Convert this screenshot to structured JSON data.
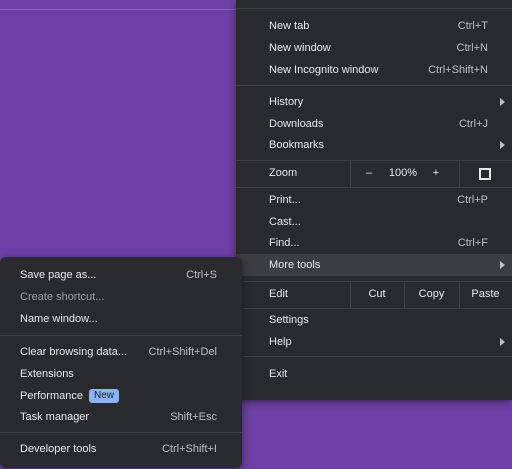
{
  "main_menu": {
    "new_tab": {
      "label": "New tab",
      "shortcut": "Ctrl+T"
    },
    "new_window": {
      "label": "New window",
      "shortcut": "Ctrl+N"
    },
    "new_incognito": {
      "label": "New Incognito window",
      "shortcut": "Ctrl+Shift+N"
    },
    "history": {
      "label": "History"
    },
    "downloads": {
      "label": "Downloads",
      "shortcut": "Ctrl+J"
    },
    "bookmarks": {
      "label": "Bookmarks"
    },
    "zoom": {
      "label": "Zoom",
      "minus": "–",
      "value": "100%",
      "plus": "+"
    },
    "print": {
      "label": "Print...",
      "shortcut": "Ctrl+P"
    },
    "cast": {
      "label": "Cast..."
    },
    "find": {
      "label": "Find...",
      "shortcut": "Ctrl+F"
    },
    "more_tools": {
      "label": "More tools"
    },
    "edit": {
      "label": "Edit",
      "cut": "Cut",
      "copy": "Copy",
      "paste": "Paste"
    },
    "settings": {
      "label": "Settings"
    },
    "help": {
      "label": "Help"
    },
    "exit": {
      "label": "Exit"
    }
  },
  "more_tools_menu": {
    "save_page": {
      "label": "Save page as...",
      "shortcut": "Ctrl+S"
    },
    "create_shortcut": {
      "label": "Create shortcut..."
    },
    "name_window": {
      "label": "Name window..."
    },
    "clear_browsing": {
      "label": "Clear browsing data...",
      "shortcut": "Ctrl+Shift+Del"
    },
    "extensions": {
      "label": "Extensions"
    },
    "performance": {
      "label": "Performance",
      "badge": "New"
    },
    "task_manager": {
      "label": "Task manager",
      "shortcut": "Shift+Esc"
    },
    "developer_tools": {
      "label": "Developer tools",
      "shortcut": "Ctrl+Shift+I"
    }
  },
  "colors": {
    "background": "#6e3fa6",
    "menu": "#292a2d",
    "badge": "#8ab4f8"
  }
}
